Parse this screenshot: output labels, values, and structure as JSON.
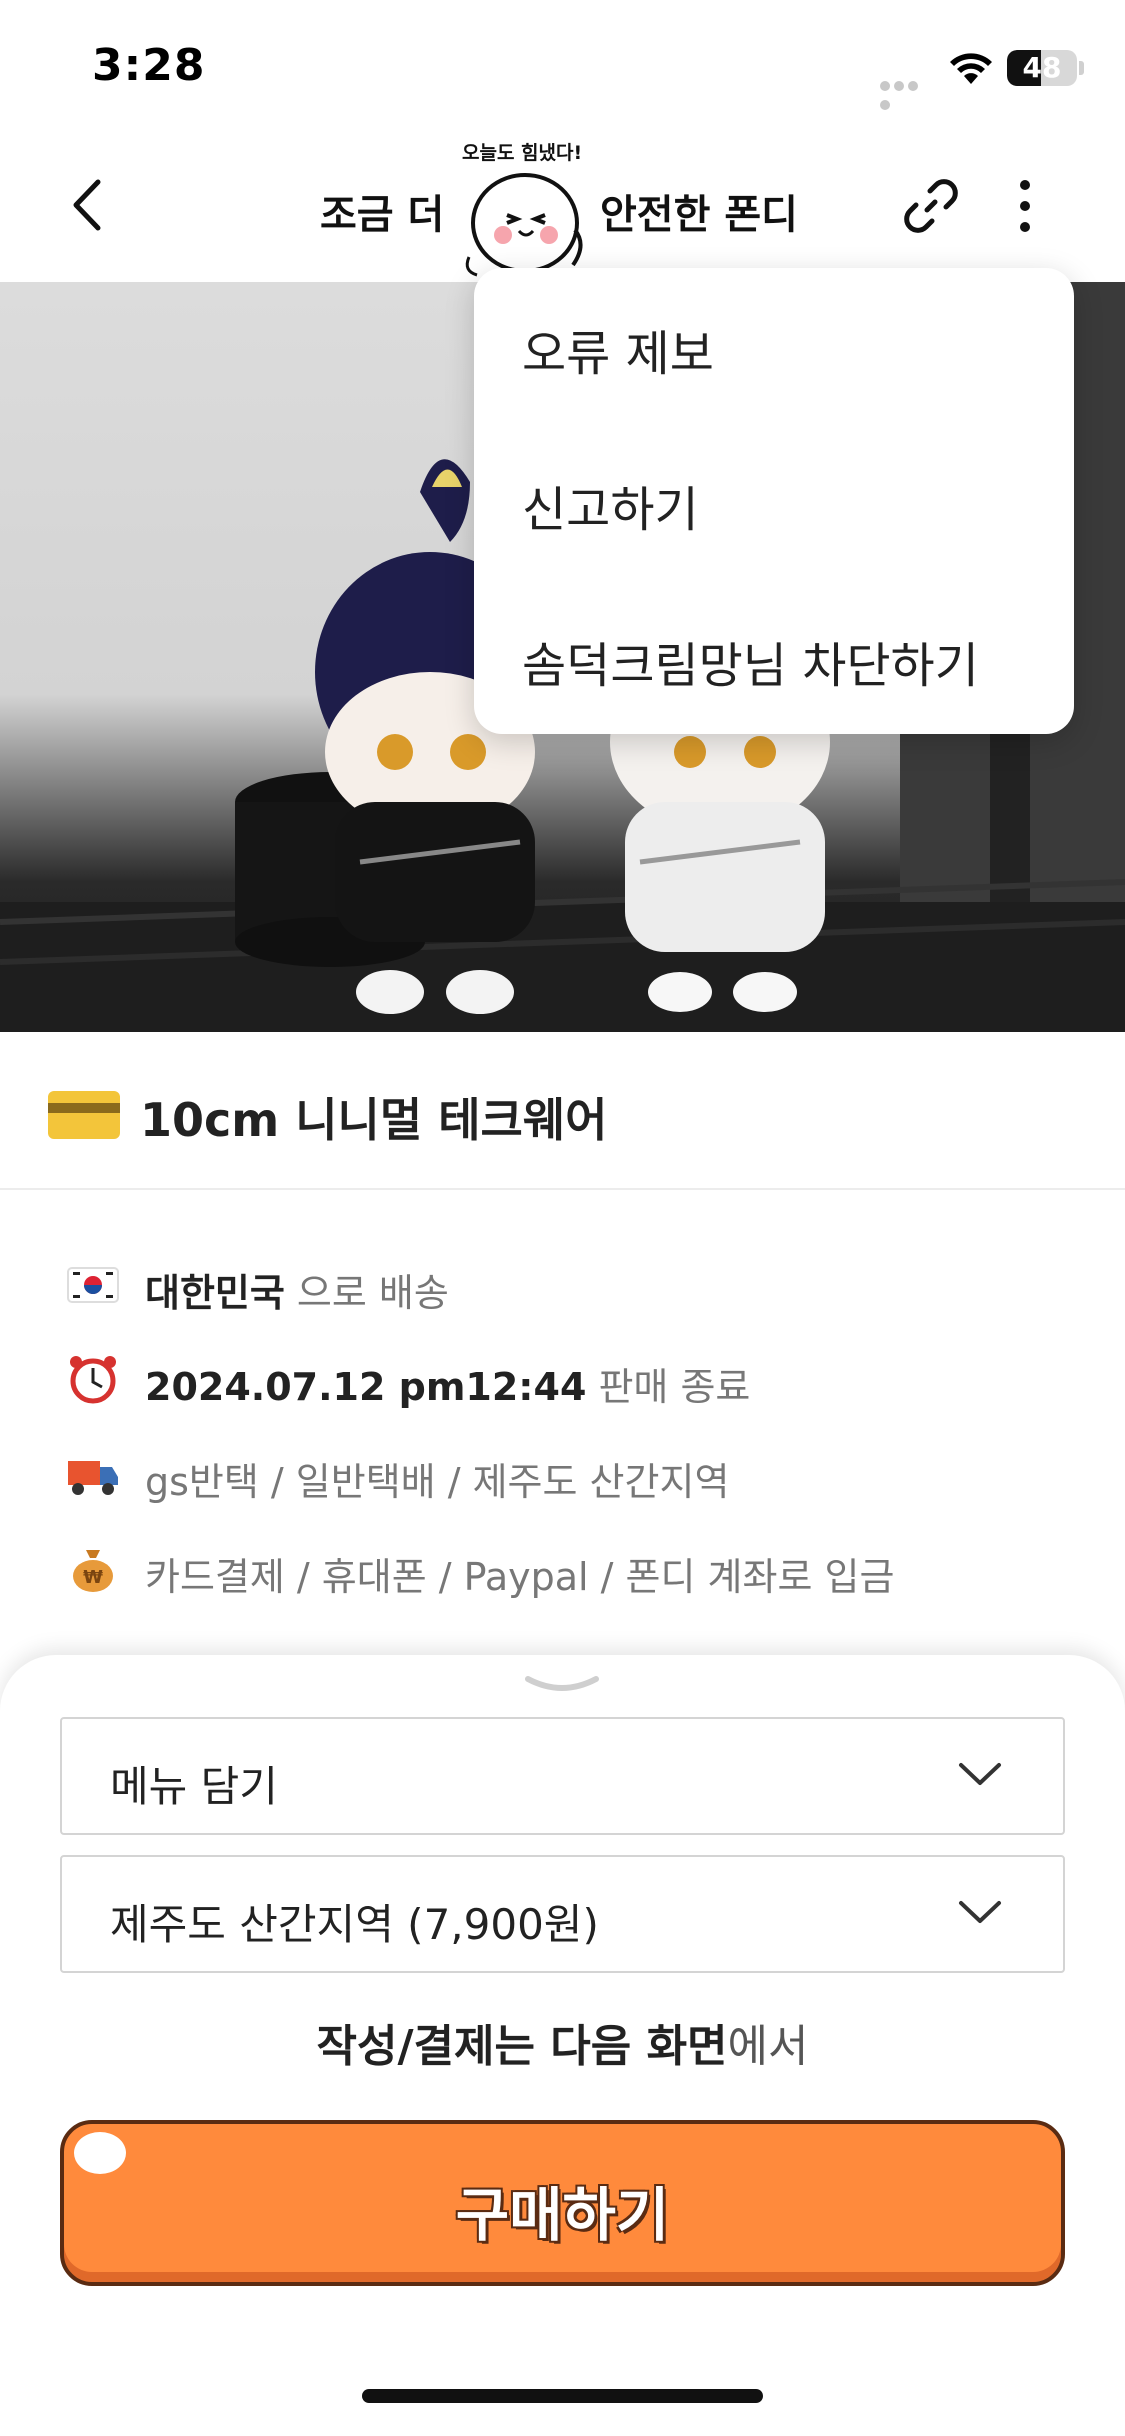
{
  "status_bar": {
    "time": "3:28",
    "battery": "48",
    "battery_level_percent": 48
  },
  "header": {
    "title_left": "조금 더",
    "title_right": "안전한 폰디",
    "mascot_caption": "오늘도 힘냈다!",
    "icons": [
      "back-icon",
      "link-icon",
      "more-vertical-icon"
    ]
  },
  "menu": {
    "items": [
      {
        "label": "오류 제보"
      },
      {
        "label": "신고하기"
      },
      {
        "label": "솜덕크림망님 차단하기"
      }
    ]
  },
  "product": {
    "title": "10cm 니니멀 테크웨어",
    "icon": "credit-card-icon"
  },
  "info": [
    {
      "icon": "korea-flag-icon",
      "bold": "대한민국",
      "text": " 으로 배송"
    },
    {
      "icon": "alarm-clock-icon",
      "bold": "2024.07.12 pm12:44",
      "text": " 판매 종료"
    },
    {
      "icon": "delivery-truck-icon",
      "bold": "",
      "text": "gs반택 / 일반택배 / 제주도 산간지역"
    },
    {
      "icon": "money-bag-icon",
      "bold": "",
      "text": "카드결제 / 휴대폰 / Paypal / 폰디 계좌로 입금"
    }
  ],
  "sheet": {
    "menu_select": "메뉴 담기",
    "shipping_select": "제주도 산간지역 (7,900원)",
    "notice_bold": "작성/결제는 다음 화면",
    "notice_rest": "에서",
    "buy_label": "구매하기"
  },
  "colors": {
    "accent": "#ff8a3c",
    "accent_border": "#5a2b12"
  }
}
